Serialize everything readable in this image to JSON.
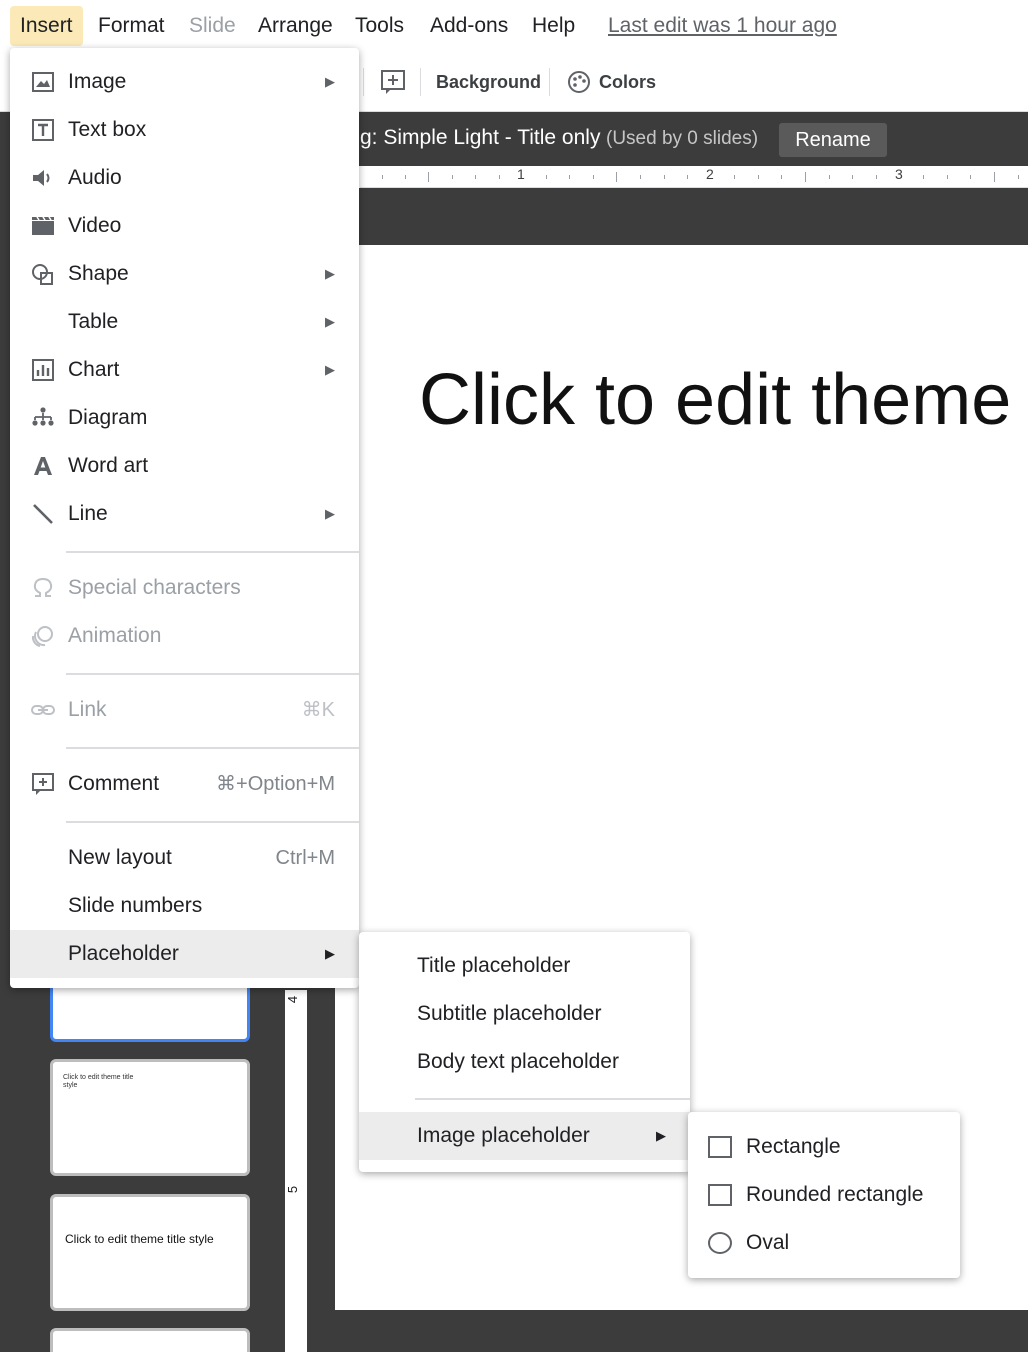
{
  "menubar": {
    "items": [
      {
        "label": "Insert",
        "state": "active"
      },
      {
        "label": "Format",
        "state": "normal"
      },
      {
        "label": "Slide",
        "state": "disabled"
      },
      {
        "label": "Arrange",
        "state": "normal"
      },
      {
        "label": "Tools",
        "state": "normal"
      },
      {
        "label": "Add-ons",
        "state": "normal"
      },
      {
        "label": "Help",
        "state": "normal"
      }
    ],
    "last_edit": "Last edit was 1 hour ago"
  },
  "toolbar": {
    "background_label": "Background",
    "colors_label": "Colors"
  },
  "theme_bar": {
    "name": "g: Simple Light - Title only",
    "used": "(Used by 0 slides)",
    "rename_label": "Rename"
  },
  "ruler": {
    "marks": [
      "1",
      "2",
      "3"
    ],
    "vertical_marks": [
      "4",
      "5"
    ]
  },
  "slide": {
    "title": "Click to edit theme"
  },
  "filmstrip": {
    "thumb2_text": "Click to edit theme title style",
    "thumb3_text": "Click to edit theme title style"
  },
  "insert_menu": {
    "items": [
      {
        "label": "Image",
        "icon": "image-icon",
        "submenu": true
      },
      {
        "label": "Text box",
        "icon": "text-box-icon"
      },
      {
        "label": "Audio",
        "icon": "audio-icon"
      },
      {
        "label": "Video",
        "icon": "video-icon"
      },
      {
        "label": "Shape",
        "icon": "shape-icon",
        "submenu": true
      },
      {
        "label": "Table",
        "icon": "",
        "submenu": true
      },
      {
        "label": "Chart",
        "icon": "chart-icon",
        "submenu": true
      },
      {
        "label": "Diagram",
        "icon": "diagram-icon"
      },
      {
        "label": "Word art",
        "icon": "word-art-icon"
      },
      {
        "label": "Line",
        "icon": "line-icon",
        "submenu": true
      },
      {
        "label": "Special characters",
        "icon": "omega-icon",
        "disabled": true
      },
      {
        "label": "Animation",
        "icon": "animation-icon",
        "disabled": true
      },
      {
        "label": "Link",
        "icon": "link-icon",
        "disabled": true,
        "shortcut": "⌘K"
      },
      {
        "label": "Comment",
        "icon": "comment-icon",
        "shortcut": "⌘+Option+M"
      },
      {
        "label": "New layout",
        "shortcut": "Ctrl+M"
      },
      {
        "label": "Slide numbers"
      },
      {
        "label": "Placeholder",
        "submenu": true,
        "highlighted": true
      }
    ]
  },
  "placeholder_menu": {
    "items": [
      {
        "label": "Title placeholder"
      },
      {
        "label": "Subtitle placeholder"
      },
      {
        "label": "Body text placeholder"
      },
      {
        "label": "Image placeholder",
        "submenu": true,
        "highlighted": true
      }
    ]
  },
  "image_placeholder_menu": {
    "items": [
      {
        "label": "Rectangle",
        "shape": "square"
      },
      {
        "label": "Rounded rectangle",
        "shape": "square"
      },
      {
        "label": "Oval",
        "shape": "circle"
      }
    ]
  },
  "colors": {
    "menu_active_bg": "#fbe9b7",
    "dark_panel": "#3c3c3c",
    "highlight": "#ececec",
    "selected_thumb": "#4285f4"
  }
}
